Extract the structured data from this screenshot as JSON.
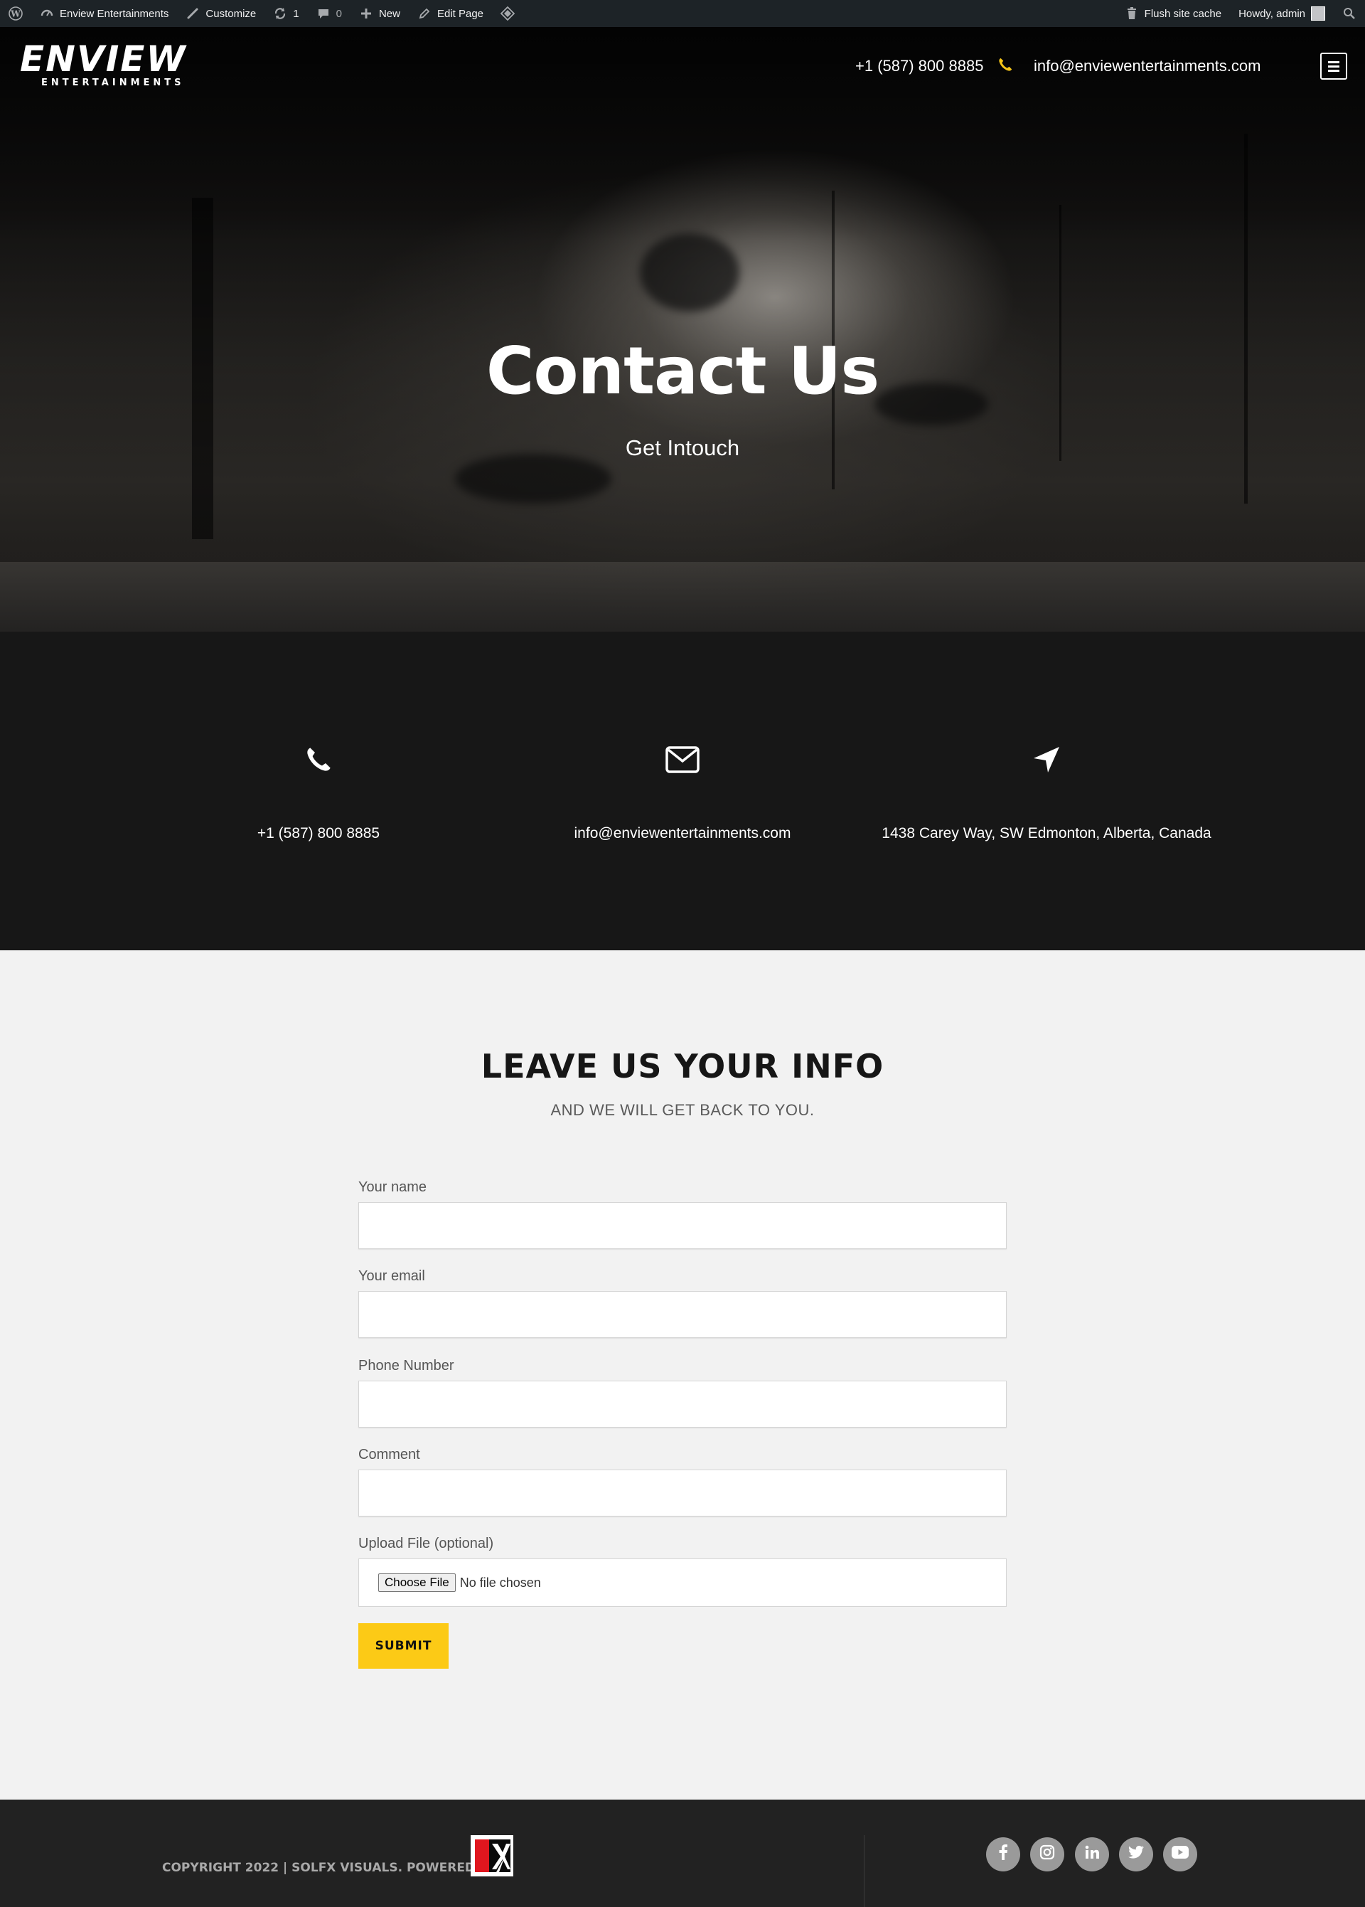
{
  "admin_bar": {
    "site_name": "Enview Entertainments",
    "customize": "Customize",
    "updates_count": "1",
    "comments_count": "0",
    "new": "New",
    "edit_page": "Edit Page",
    "flush_cache": "Flush site cache",
    "howdy": "Howdy, admin"
  },
  "header": {
    "logo_main": "ENVIEW",
    "logo_sub": "ENTERTAINMENTS",
    "phone": "+1 (587) 800 8885",
    "email": "info@enviewentertainments.com"
  },
  "hero": {
    "title": "Contact Us",
    "subtitle": "Get Intouch"
  },
  "contact_info": {
    "phone": "+1 (587) 800 8885",
    "email": "info@enviewentertainments.com",
    "address": "1438 Carey Way, SW Edmonton, Alberta, Canada"
  },
  "form": {
    "title": "LEAVE US YOUR INFO",
    "subtitle": "AND WE WILL GET BACK TO YOU.",
    "name_label": "Your name",
    "email_label": "Your email",
    "phone_label": "Phone Number",
    "comment_label": "Comment",
    "upload_label": "Upload File (optional)",
    "choose_file": "Choose File",
    "no_file": "No file chosen",
    "submit": "SUBMIT"
  },
  "footer": {
    "copyright": "COPYRIGHT 2022 | SOLFX VISUALS. POWERED BY :",
    "social": [
      "facebook",
      "instagram",
      "linkedin",
      "twitter",
      "youtube"
    ]
  },
  "colors": {
    "accent": "#fcca16",
    "admin_bar": "#1d2327",
    "dark_band": "#171717",
    "footer": "#222222"
  }
}
